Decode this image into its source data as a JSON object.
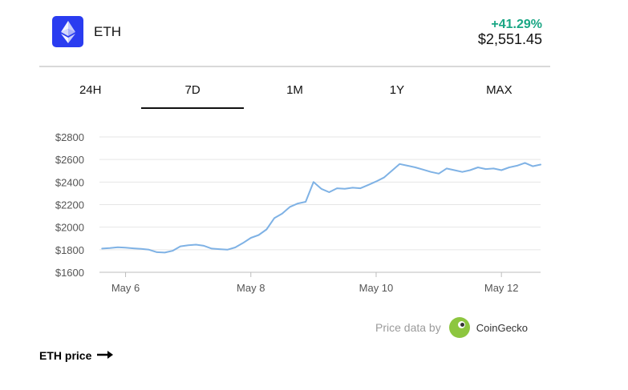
{
  "header": {
    "coin_name": "ETH",
    "change": "+41.29%",
    "price": "$2,551.45",
    "logo_icon": "ethereum-icon"
  },
  "tabs": [
    {
      "label": "24H",
      "active": false
    },
    {
      "label": "7D",
      "active": true
    },
    {
      "label": "1M",
      "active": false
    },
    {
      "label": "1Y",
      "active": false
    },
    {
      "label": "MAX",
      "active": false
    }
  ],
  "colors": {
    "line": "#7fb2e5",
    "positive": "#1aa684",
    "logo_bg": "#2a3cf0",
    "grid": "#e6e6e6"
  },
  "chart_data": {
    "type": "line",
    "title": "",
    "xlabel": "",
    "ylabel": "",
    "ylim": [
      1600,
      2800
    ],
    "y_ticks": [
      1600,
      1800,
      2000,
      2200,
      2400,
      2600,
      2800
    ],
    "y_tick_labels": [
      "$1600",
      "$1800",
      "$2000",
      "$2200",
      "$2400",
      "$2600",
      "$2800"
    ],
    "x_tick_labels": [
      "May 6",
      "May 8",
      "May 10",
      "May 12"
    ],
    "x_tick_values": [
      "2021-05-06",
      "2021-05-08",
      "2021-05-10",
      "2021-05-12"
    ],
    "grid": true,
    "series": [
      {
        "x": [
          "2021-05-05T15:00",
          "2021-05-05T18:00",
          "2021-05-05T21:00",
          "2021-05-06T00:00",
          "2021-05-06T03:00",
          "2021-05-06T06:00",
          "2021-05-06T09:00",
          "2021-05-06T12:00",
          "2021-05-06T15:00",
          "2021-05-06T18:00",
          "2021-05-06T21:00",
          "2021-05-07T00:00",
          "2021-05-07T03:00",
          "2021-05-07T06:00",
          "2021-05-07T09:00",
          "2021-05-07T12:00",
          "2021-05-07T15:00",
          "2021-05-07T18:00",
          "2021-05-07T21:00",
          "2021-05-08T00:00",
          "2021-05-08T03:00",
          "2021-05-08T06:00",
          "2021-05-08T09:00",
          "2021-05-08T12:00",
          "2021-05-08T15:00",
          "2021-05-08T18:00",
          "2021-05-08T21:00",
          "2021-05-09T00:00",
          "2021-05-09T03:00",
          "2021-05-09T06:00",
          "2021-05-09T09:00",
          "2021-05-09T12:00",
          "2021-05-09T15:00",
          "2021-05-09T18:00",
          "2021-05-09T21:00",
          "2021-05-10T00:00",
          "2021-05-10T03:00",
          "2021-05-10T06:00",
          "2021-05-10T09:00",
          "2021-05-10T12:00",
          "2021-05-10T15:00",
          "2021-05-10T18:00",
          "2021-05-10T21:00",
          "2021-05-11T00:00",
          "2021-05-11T03:00",
          "2021-05-11T06:00",
          "2021-05-11T09:00",
          "2021-05-11T12:00",
          "2021-05-11T15:00",
          "2021-05-11T18:00",
          "2021-05-11T21:00",
          "2021-05-12T00:00",
          "2021-05-12T03:00",
          "2021-05-12T06:00",
          "2021-05-12T09:00",
          "2021-05-12T12:00",
          "2021-05-12T15:00"
        ],
        "values": [
          1810,
          1815,
          1822,
          1818,
          1812,
          1808,
          1800,
          1778,
          1775,
          1790,
          1830,
          1840,
          1845,
          1835,
          1810,
          1805,
          1800,
          1820,
          1860,
          1905,
          1930,
          1980,
          2080,
          2120,
          2180,
          2210,
          2225,
          2400,
          2340,
          2310,
          2345,
          2340,
          2350,
          2345,
          2375,
          2405,
          2440,
          2500,
          2560,
          2545,
          2530,
          2510,
          2490,
          2475,
          2520,
          2505,
          2490,
          2505,
          2530,
          2515,
          2520,
          2505,
          2530,
          2545,
          2570,
          2540,
          2555
        ]
      }
    ]
  },
  "credit": {
    "prefix": "Price data by",
    "brand": "CoinGecko",
    "brand_icon": "coingecko-icon"
  },
  "footer": {
    "link_label": "ETH price",
    "arrow_icon": "arrow-right-icon"
  }
}
